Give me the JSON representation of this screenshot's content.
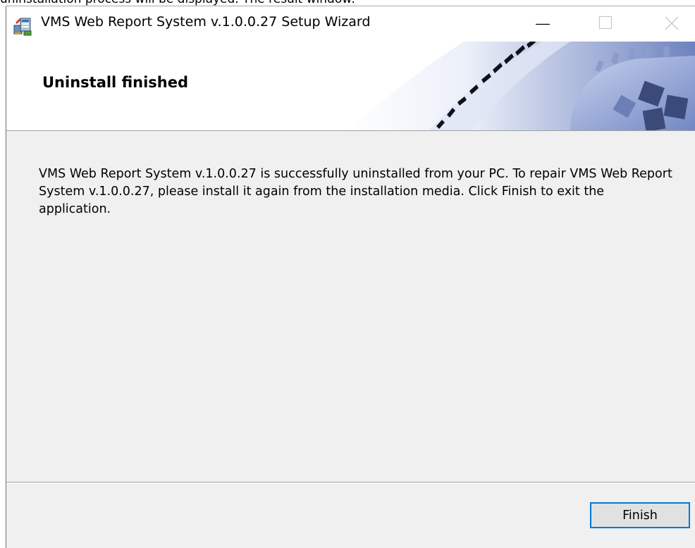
{
  "window": {
    "title": "VMS Web Report System v.1.0.0.27 Setup Wizard",
    "app_icon": "installer-icon",
    "controls": {
      "minimize_icon": "minimize-icon",
      "maximize_icon": "maximize-icon",
      "close_icon": "close-icon"
    }
  },
  "caption_above": "uninstallation process will be displayed. The result window:",
  "header": {
    "title": "Uninstall finished",
    "banner_art": "gears-banner"
  },
  "body": {
    "message": "VMS Web Report System v.1.0.0.27 is successfully uninstalled from your PC. To repair VMS Web Report System v.1.0.0.27, please install it again from the installation media. Click Finish to exit the application."
  },
  "footer": {
    "finish_label": "Finish"
  },
  "colors": {
    "focus_border": "#0078d7",
    "dialog_bg": "#f0f0f0",
    "button_bg": "#e1e1e1"
  }
}
